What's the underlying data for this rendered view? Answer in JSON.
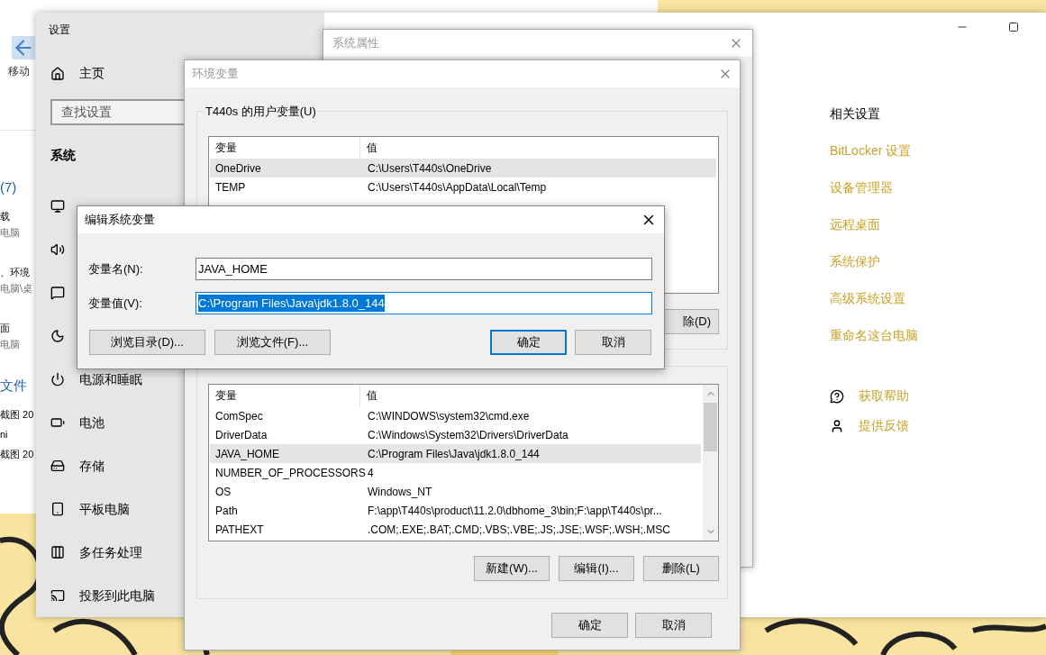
{
  "explorer": {
    "ribbon_button": "移动",
    "items": [
      {
        "text": "(7)",
        "kind": "group"
      },
      {
        "text": "载",
        "kind": "name"
      },
      {
        "text": "电脑",
        "kind": "path"
      },
      {
        "text": "、环境",
        "kind": "name"
      },
      {
        "text": "电脑\\桌",
        "kind": "path"
      },
      {
        "text": "面",
        "kind": "name"
      },
      {
        "text": "电脑",
        "kind": "path"
      },
      {
        "text": "文件",
        "kind": "group"
      },
      {
        "text": "截图 20",
        "kind": "name"
      },
      {
        "text": "ni",
        "kind": "name"
      },
      {
        "text": "截图 20",
        "kind": "name"
      }
    ]
  },
  "settings": {
    "title": "设置",
    "home": "主页",
    "search": {
      "placeholder": "查找设置"
    },
    "section": "系统",
    "nav": [
      {
        "label": "电源和睡眠"
      },
      {
        "label": "电池"
      },
      {
        "label": "存储"
      },
      {
        "label": "平板电脑"
      },
      {
        "label": "多任务处理"
      },
      {
        "label": "投影到此电脑"
      }
    ],
    "related": {
      "heading": "相关设置",
      "links": [
        "BitLocker 设置",
        "设备管理器",
        "远程桌面",
        "系统保护",
        "高级系统设置",
        "重命名这台电脑"
      ]
    },
    "support": [
      "获取帮助",
      "提供反馈"
    ]
  },
  "system_properties": {
    "title": "系统属性"
  },
  "environment": {
    "title": "环境变量",
    "user_group": "T440s 的用户变量(U)",
    "user_vars": {
      "columns": [
        "变量",
        "值"
      ],
      "rows": [
        {
          "name": "OneDrive",
          "value": "C:\\Users\\T440s\\OneDrive",
          "selected": true
        },
        {
          "name": "TEMP",
          "value": "C:\\Users\\T440s\\AppData\\Local\\Temp",
          "selected": false
        }
      ]
    },
    "user_buttons": [
      "除(D)"
    ],
    "system_vars": {
      "columns": [
        "变量",
        "值"
      ],
      "rows": [
        {
          "name": "ComSpec",
          "value": "C:\\WINDOWS\\system32\\cmd.exe",
          "selected": false
        },
        {
          "name": "DriverData",
          "value": "C:\\Windows\\System32\\Drivers\\DriverData",
          "selected": false
        },
        {
          "name": "JAVA_HOME",
          "value": "C:\\Program Files\\Java\\jdk1.8.0_144",
          "selected": true
        },
        {
          "name": "NUMBER_OF_PROCESSORS",
          "value": "4",
          "selected": false
        },
        {
          "name": "OS",
          "value": "Windows_NT",
          "selected": false
        },
        {
          "name": "Path",
          "value": "F:\\app\\T440s\\product\\11.2.0\\dbhome_3\\bin;F:\\app\\T440s\\pr...",
          "selected": false
        },
        {
          "name": "PATHEXT",
          "value": ".COM;.EXE;.BAT;.CMD;.VBS;.VBE;.JS;.JSE;.WSF;.WSH;.MSC",
          "selected": false
        }
      ]
    },
    "system_buttons": [
      "新建(W)...",
      "编辑(I)...",
      "删除(L)"
    ],
    "buttons": [
      "确定",
      "取消"
    ]
  },
  "edit_dialog": {
    "title": "编辑系统变量",
    "fields": [
      {
        "label": "变量名(N):",
        "value": "JAVA_HOME",
        "highlighted": false
      },
      {
        "label": "变量值(V):",
        "value": "C:\\Program Files\\Java\\jdk1.8.0_144",
        "highlighted": true
      }
    ],
    "buttons": [
      {
        "label": "浏览目录(D)...",
        "default": false
      },
      {
        "label": "浏览文件(F)...",
        "default": false
      },
      {
        "label": "确定",
        "default": true
      },
      {
        "label": "取消",
        "default": false
      }
    ]
  }
}
